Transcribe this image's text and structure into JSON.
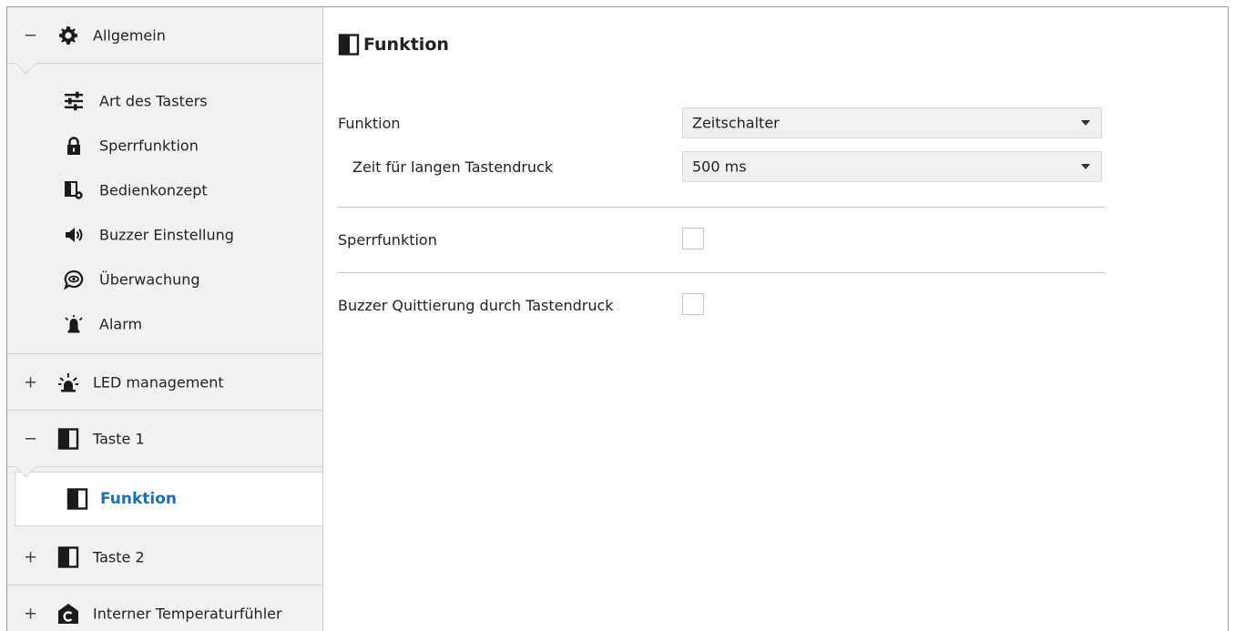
{
  "sidebar": {
    "allgemein": {
      "toggle": "−",
      "icon": "gear-icon",
      "label": "Allgemein",
      "items": [
        {
          "label": "Art des Tasters",
          "icon": "sliders-icon"
        },
        {
          "label": "Sperrfunktion",
          "icon": "lock-icon"
        },
        {
          "label": "Bedienkonzept",
          "icon": "panel-gear-icon"
        },
        {
          "label": "Buzzer Einstellung",
          "icon": "speaker-icon"
        },
        {
          "label": "Überwachung",
          "icon": "eye-bubble-icon"
        },
        {
          "label": "Alarm",
          "icon": "alarm-bell-icon"
        }
      ]
    },
    "led": {
      "toggle": "+",
      "icon": "led-light-icon",
      "label": "LED management"
    },
    "taste1": {
      "toggle": "−",
      "icon": "button-panel-icon",
      "label": "Taste 1",
      "active_item": {
        "label": "Funktion",
        "icon": "button-panel-icon"
      }
    },
    "taste2": {
      "toggle": "+",
      "icon": "button-panel-icon",
      "label": "Taste 2"
    },
    "temp": {
      "toggle": "+",
      "icon": "temperature-sensor-icon",
      "label": "Interner Temperaturfühler"
    }
  },
  "main": {
    "title": "Funktion",
    "title_icon": "button-panel-icon",
    "funktion": {
      "label": "Funktion",
      "value": "Zeitschalter"
    },
    "zeit": {
      "label": "Zeit für langen Tastendruck",
      "value": "500 ms"
    },
    "sperrfunktion": {
      "label": "Sperrfunktion",
      "checked": false
    },
    "buzzer": {
      "label": "Buzzer Quittierung durch Tastendruck",
      "checked": false
    }
  },
  "colors": {
    "accent": "#1a6fb5",
    "sidebar_bg": "#f1f1f1",
    "select_bg": "#f0f0f0"
  }
}
